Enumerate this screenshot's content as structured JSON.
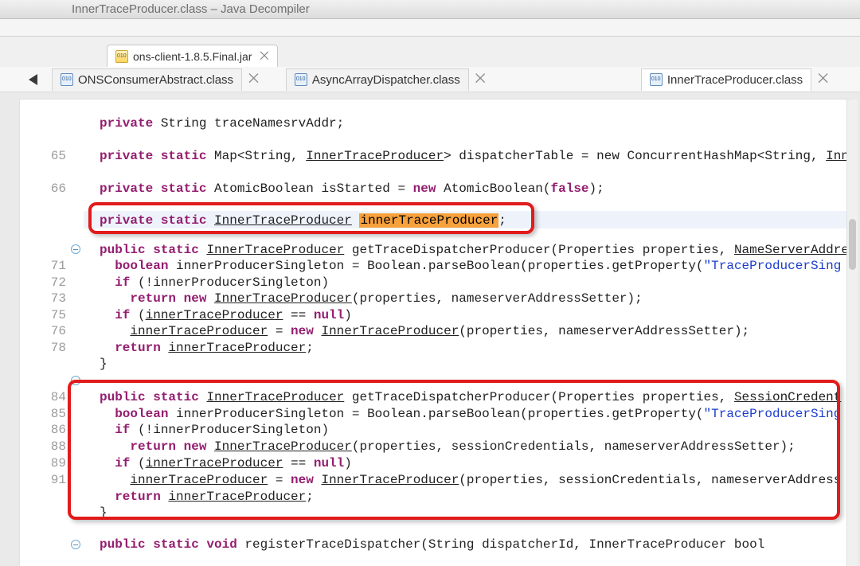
{
  "window": {
    "title": "InnerTraceProducer.class – Java Decompiler"
  },
  "jar_tab": {
    "label": "ons-client-1.8.5.Final.jar",
    "close": "⨉"
  },
  "tabs": {
    "back_name": "back-button",
    "t1": "ONSConsumerAbstract.class",
    "t2": "AsyncArrayDispatcher.class",
    "t3": "InnerTraceProducer.class",
    "close": "⨉"
  },
  "gutter": [
    "65",
    "66",
    "71",
    "72",
    "73",
    "75",
    "76",
    "78",
    "84",
    "85",
    "86",
    "88",
    "89",
    "91"
  ],
  "gutter_y": [
    62,
    103,
    200,
    221,
    241,
    262,
    282,
    303,
    365,
    386,
    406,
    427,
    448,
    469
  ],
  "folds_y": [
    179,
    344,
    550
  ],
  "code": {
    "l0": "private String traceNamesrvAddr;",
    "l1a": "private static Map<String, ",
    "l1b": "InnerTraceProducer",
    "l1c": "> dispatcherTable = new ConcurrentHashMap<String, ",
    "l1d": "Inn",
    "l2a": "private static AtomicBoolean isStarted = ",
    "l2b": "new",
    "l2c": " AtomicBoolean(",
    "l2d": "false",
    "l2e": ");",
    "l3a": "private static ",
    "l3b": "InnerTraceProducer",
    "l3c": " ",
    "l3d": "innerTraceProducer",
    "l3e": ";",
    "l4a": "public static ",
    "l4b": "InnerTraceProducer",
    "l4c": " getTraceDispatcherProducer(Properties properties, ",
    "l4d": "NameServerAddre",
    "l5a": "  boolean innerProducerSingleton = Boolean.parseBoolean(properties.getProperty(",
    "l5b": "\"TraceProducerSing",
    "l6": "  if (!innerProducerSingleton)",
    "l7a": "    return new ",
    "l7b": "InnerTraceProducer",
    "l7c": "(properties, nameserverAddressSetter);",
    "l8a": "  if (",
    "l8b": "innerTraceProducer",
    "l8c": " == null)",
    "l9a": "    ",
    "l9b": "innerTraceProducer",
    "l9c": " = new ",
    "l9d": "InnerTraceProducer",
    "l9e": "(properties, nameserverAddressSetter);",
    "l10a": "  return ",
    "l10b": "innerTraceProducer",
    "l10c": ";",
    "l11": "}",
    "l12a": "public static ",
    "l12b": "InnerTraceProducer",
    "l12c": " getTraceDispatcherProducer(Properties properties, ",
    "l12d": "SessionCredent",
    "l13a": "  boolean innerProducerSingleton = Boolean.parseBoolean(properties.getProperty(",
    "l13b": "\"TraceProducerSing",
    "l14": "  if (!innerProducerSingleton)",
    "l15a": "    return new ",
    "l15b": "InnerTraceProducer",
    "l15c": "(properties, sessionCredentials, nameserverAddressSetter);",
    "l16a": "  if (",
    "l16b": "innerTraceProducer",
    "l16c": " == null)",
    "l17a": "    ",
    "l17b": "innerTraceProducer",
    "l17c": " = new ",
    "l17d": "InnerTraceProducer",
    "l17e": "(properties, sessionCredentials, nameserverAddress",
    "l18a": "  return ",
    "l18b": "innerTraceProducer",
    "l18c": ";",
    "l19": "}",
    "l20a": "public static void",
    "l20b": " registerTraceDispatcher(String dispatcherId, InnerTraceProducer bool"
  }
}
